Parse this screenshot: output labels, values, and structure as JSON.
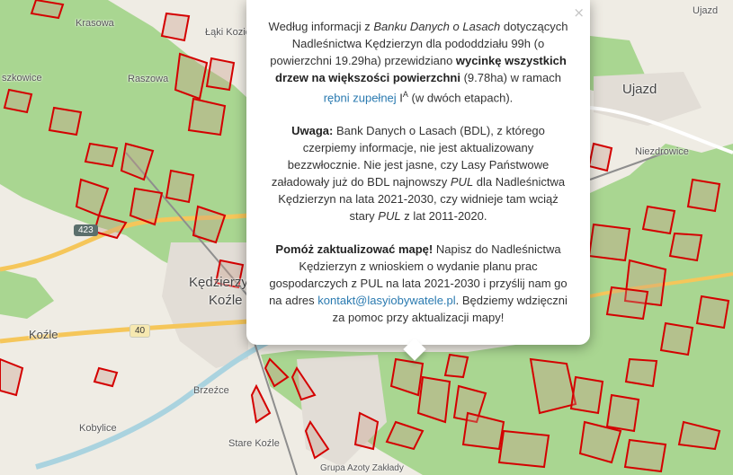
{
  "map": {
    "places": {
      "krasowa": "Krasowa",
      "laki": "Łąki Kozieł",
      "szkowice": "szkowice",
      "raszowa": "Raszowa",
      "ujazd_top": "Ujazd",
      "ujazd": "Ujazd",
      "niezdrowice": "Niezdrowice",
      "kedzierzyn": "Kędzierzyn",
      "kozle_city": "Koźle",
      "kozle": "Koźle",
      "brzezce": "Brzeźce",
      "kobylice": "Kobylice",
      "stare_kozle": "Stare Koźle",
      "azoty": "Grupa Azoty Zakłady"
    },
    "roads": {
      "r423": "423",
      "r40": "40"
    },
    "colors": {
      "land": "#efece4",
      "forest": "#a9d691",
      "parcel_stroke": "#d40000",
      "parcel_fill": "#b99a6a",
      "popup_bg": "#ffffff",
      "link": "#2a7ab0"
    }
  },
  "popup": {
    "close_label": "×",
    "p1": {
      "t1": "Według informacji z ",
      "source": "Banku Danych o Lasach",
      "t2": " dotyczących Nadleśnictwa Kędzierzyn dla pododdziału 99h (o powierzchni 19.29ha) przewidziano ",
      "bold": "wycinkę wszystkich drzew na większości powierzchni",
      "t3": " (9.78ha) w ramach ",
      "link": "rębni zupełnej",
      "code": "I",
      "code_sup": "A",
      "t4": " (w dwóch etapach)."
    },
    "p2": {
      "bold": "Uwaga:",
      "t1": " Bank Danych o Lasach (BDL), z którego czerpiemy informacje, nie jest aktualizowany bezzwłocznie. Nie jest jasne, czy Lasy Państwowe załadowały już do BDL najnowszy ",
      "pul1": "PUL",
      "t2": " dla Nadleśnictwa Kędzierzyn na lata 2021-2030, czy widnieje tam wciąż stary ",
      "pul2": "PUL",
      "t3": " z lat 2011-2020."
    },
    "p3": {
      "bold": "Pomóż zaktualizować mapę!",
      "t1": " Napisz do Nadleśnictwa Kędzierzyn z wnioskiem o wydanie planu prac gospodarczych z PUL na lata 2021-2030 i przyślij nam go na adres ",
      "email": "kontakt@lasyiobywatele.pl",
      "t2": ". Będziemy wdzięczni za pomoc przy aktualizacji mapy!"
    }
  }
}
